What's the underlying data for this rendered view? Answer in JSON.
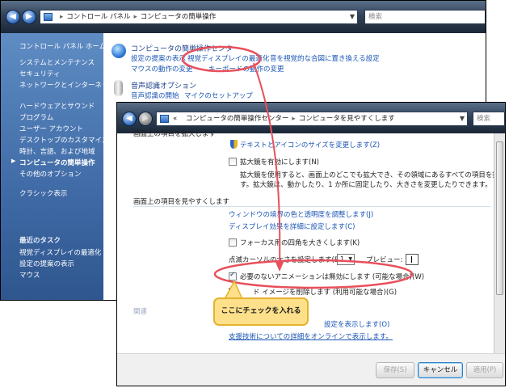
{
  "back_window": {
    "address": [
      "コントロール パネル",
      "コンピュータの簡単操作"
    ],
    "search_placeholder": "検索",
    "sidebar": {
      "items": [
        "コントロール パネル ホーム",
        "システムとメンテナンス",
        "セキュリティ",
        "ネットワークとインターネット",
        "ハードウェアとサウンド",
        "プログラム",
        "ユーザー アカウント",
        "デスクトップのカスタマイズ",
        "時計、言語、および地域",
        "コンピュータの簡単操作",
        "その他のオプション",
        "クラシック表示"
      ],
      "current_index": 9,
      "recent_title": "最近のタスク",
      "recent_items": [
        "視覚ディスプレイの最適化",
        "設定の提案の表示",
        "マウス"
      ]
    },
    "categories": [
      {
        "title": "コンピュータの簡単操作センター",
        "links": [
          "設定の提案の表示",
          "視覚ディスプレイの最適化",
          "音を視覚的な合図に置き換える設定",
          "マウスの動作の変更",
          "キーボードの動作の変更"
        ]
      },
      {
        "title": "音声認識オプション",
        "links": [
          "音声認識の開始",
          "マイクのセットアップ"
        ]
      }
    ]
  },
  "front_window": {
    "address": [
      "コンピュータの簡単操作センター",
      "コンピュータを見やすくします"
    ],
    "address_prefix": "«",
    "search_placeholder": "検索",
    "section1": {
      "heading": "画面上の項目を拡大します",
      "link_text_size": "テキストとアイコンのサイズを変更します(Z)",
      "magnifier_label": "拡大鏡を有効にします(N)",
      "magnifier_desc1": "拡大鏡を使用すると、画面上のどこでも拡大でき、その領域にあるすべての項目を拡大表示できま",
      "magnifier_desc2": "す。拡大鏡は、動かしたり、1 か所に固定したり、大きさを変更したりできます。"
    },
    "section2": {
      "heading": "画面上の項目を見やすくします",
      "link_window_color": "ウィンドウの境界の色と透明度を調整します(J)",
      "link_visual_effects": "ディスプレイ効果を詳細に設定します(C)",
      "focus_label": "フォーカス用の四角を大きくします(K)",
      "cursor_label": "点滅カーソルの太さを設定します(B):",
      "cursor_value": "1",
      "preview_label": "プレビュー:",
      "animation_label": "必要のないアニメーションは無効にします (可能な場合)(W)",
      "animation_checked": true,
      "bg_label": "ド イメージを削除します (利用可能な場合)(G)",
      "bg_checked": false
    },
    "section3": {
      "fragment_a": "関連",
      "link_settings": "設定を表示します(O)",
      "link_online": "支援技術についての詳細をオンラインで表示します。"
    },
    "buttons": {
      "save": "保存(S)",
      "cancel": "キャンセル",
      "apply": "適用(P)"
    }
  },
  "callout_text": "ここにチェックを入れる",
  "colors": {
    "annotation_red": "#e8505b",
    "callout_fill": "#ffe08a",
    "link_blue": "#1a55b4"
  }
}
